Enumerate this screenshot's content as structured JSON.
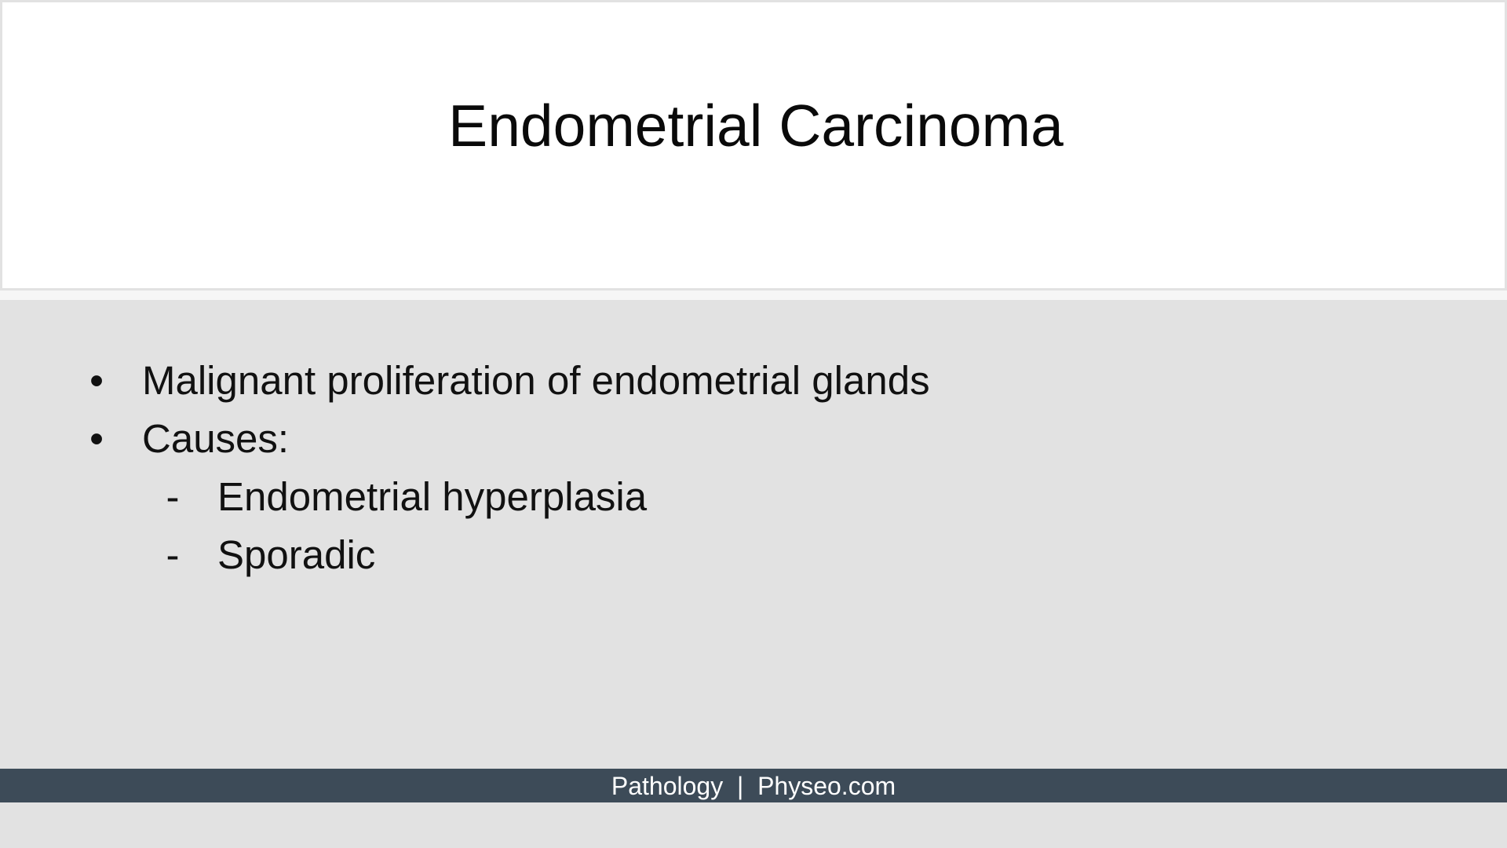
{
  "slide": {
    "title": "Endometrial Carcinoma",
    "bullets": [
      {
        "level": 1,
        "marker": "•",
        "text": "Malignant proliferation of endometrial glands"
      },
      {
        "level": 1,
        "marker": "•",
        "text": "Causes:"
      },
      {
        "level": 2,
        "marker": "-",
        "text": "Endometrial hyperplasia"
      },
      {
        "level": 2,
        "marker": "-",
        "text": "Sporadic"
      }
    ],
    "footer": {
      "subject": "Pathology",
      "separator": "|",
      "site": "Physeo.com"
    }
  },
  "colors": {
    "title_background": "#ffffff",
    "content_background": "#e2e2e2",
    "footer_background": "#3d4b58",
    "footer_text": "#ffffff",
    "text": "#111111"
  }
}
